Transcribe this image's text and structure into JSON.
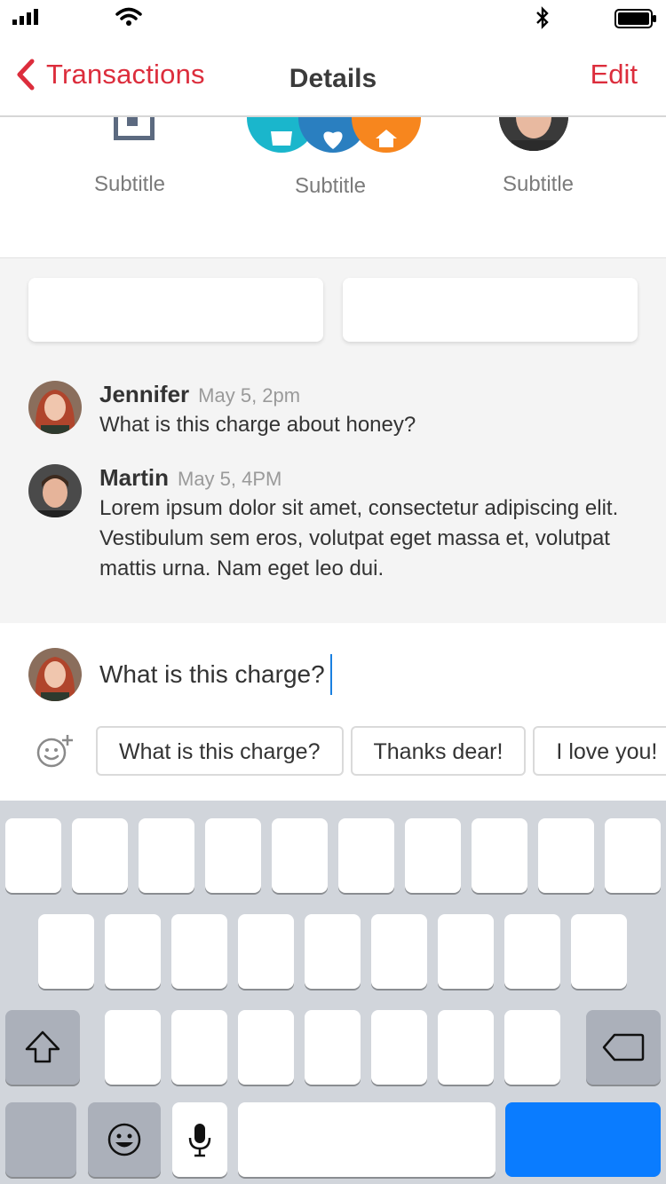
{
  "nav": {
    "back_label": "Transactions",
    "title": "Details",
    "edit_label": "Edit"
  },
  "header": {
    "items": [
      {
        "subtitle": "Subtitle",
        "icon": "square-icon"
      },
      {
        "subtitle": "Subtitle",
        "icons": [
          "shopping-bag-icon",
          "heart-icon",
          "home-icon"
        ]
      },
      {
        "subtitle": "Subtitle",
        "icon": "avatar"
      }
    ]
  },
  "comments": [
    {
      "name": "Jennifer",
      "date": "May 5, 2pm",
      "text": "What is this charge about honey?"
    },
    {
      "name": "Martin",
      "date": "May 5, 4PM",
      "text": "Lorem ipsum dolor sit amet, consectetur adipiscing elit. Vestibulum sem eros, volutpat eget massa et, volutpat mattis urna. Nam eget leo dui."
    }
  ],
  "compose": {
    "value": "What is this charge?",
    "quick_replies": [
      "What is this charge?",
      "Thanks dear!",
      "I love you!"
    ]
  },
  "colors": {
    "accent": "#dc2d3c",
    "teal": "#1ab6cc",
    "blue": "#2a7fc0",
    "orange": "#f7861e",
    "keyboard_bg": "#d1d5db",
    "return_key": "#0a7cff"
  }
}
